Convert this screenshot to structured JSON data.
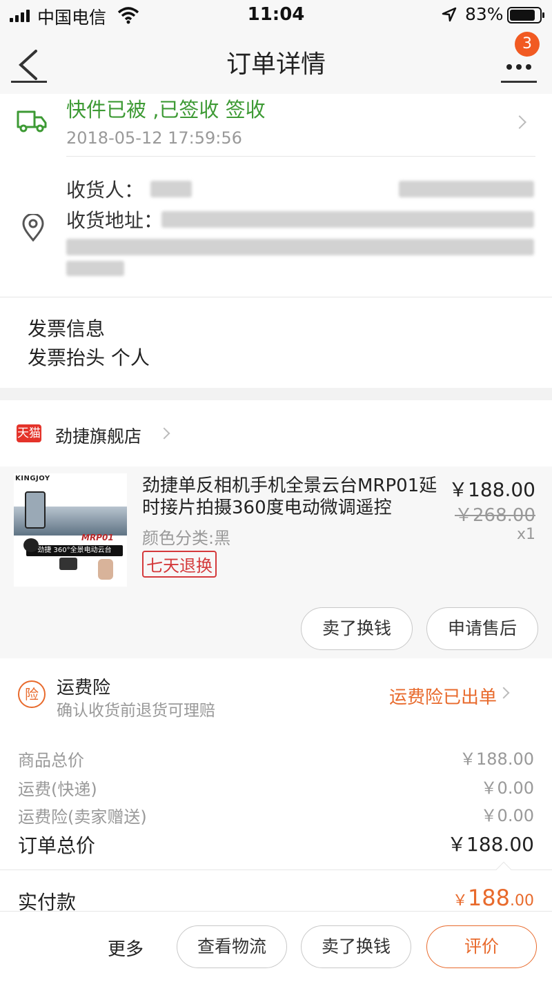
{
  "status_bar": {
    "carrier": "中国电信",
    "time": "11:04",
    "battery": "83%"
  },
  "nav": {
    "title": "订单详情",
    "badge_count": "3",
    "more_icon": "more-dots-icon"
  },
  "logistics": {
    "status": "快件已被 ,已签收 签收",
    "timestamp": "2018-05-12 17:59:56"
  },
  "address": {
    "receiver_label": "收货人：",
    "address_label": "收货地址："
  },
  "invoice": {
    "title": "发票信息",
    "header_line": "发票抬头 个人"
  },
  "store": {
    "badge": "天猫",
    "name": "劲捷旗舰店"
  },
  "product": {
    "brand": "KINGJOY",
    "image_model": "MRP01",
    "image_caption": "劲捷 360°全景电动云台",
    "title": "劲捷单反相机手机全景云台MRP01延时接片拍摄360度电动微调遥控",
    "variant": "颜色分类:黑",
    "tag": "七天退换",
    "price": "￥188.00",
    "original_price": "￥268.00",
    "quantity": "x1",
    "btn_sell": "卖了换钱",
    "btn_aftersale": "申请售后"
  },
  "insurance": {
    "icon_char": "险",
    "title": "运费险",
    "subtitle": "确认收货前退货可理赔",
    "status": "运费险已出单"
  },
  "summary": {
    "rows": [
      {
        "label": "商品总价",
        "value": "￥188.00"
      },
      {
        "label": "运费(快递)",
        "value": "￥0.00"
      },
      {
        "label": "运费险(卖家赠送)",
        "value": "￥0.00"
      }
    ],
    "total_label": "订单总价",
    "total_value": "￥188.00",
    "paid_label": "实付款",
    "paid_symbol": "￥",
    "paid_int": "188",
    "paid_dec": ".00"
  },
  "bottom_bar": {
    "more": "更多",
    "btn_logistics": "查看物流",
    "btn_sell": "卖了换钱",
    "btn_review": "评价"
  },
  "colors": {
    "accent": "#e86a2c",
    "green": "#3d9a34",
    "badge": "#f15a22",
    "tag_red": "#d4393b"
  }
}
